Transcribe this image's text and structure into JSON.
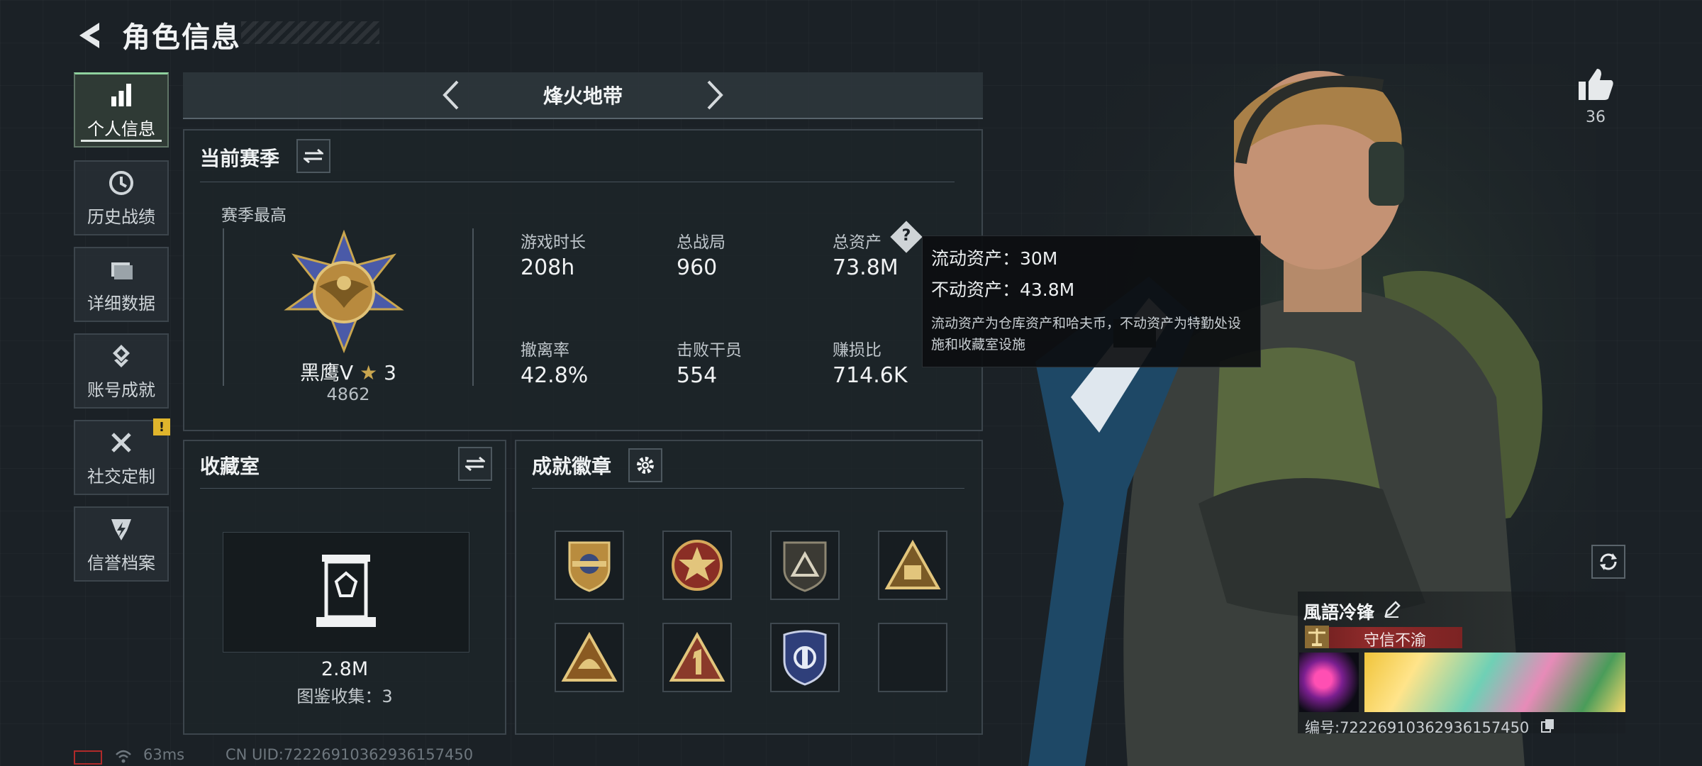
{
  "page": {
    "title": "角色信息"
  },
  "nav": [
    {
      "label": "个人信息",
      "icon": "bar-chart-icon",
      "active": true
    },
    {
      "label": "历史战绩",
      "icon": "history-clock-icon"
    },
    {
      "label": "详细数据",
      "icon": "folder-icon"
    },
    {
      "label": "账号成就",
      "icon": "achievement-icon"
    },
    {
      "label": "社交定制",
      "icon": "tools-icon",
      "alert": "!"
    },
    {
      "label": "信誉档案",
      "icon": "shield-bolt-icon"
    }
  ],
  "mode": {
    "current": "烽火地带"
  },
  "season": {
    "title": "当前赛季",
    "best_label": "赛季最高",
    "rank_name": "黑鹰Ⅴ",
    "rank_stars": "3",
    "rank_points": "4862",
    "stats": [
      {
        "label": "游戏时长",
        "value": "208h"
      },
      {
        "label": "总战局",
        "value": "960"
      },
      {
        "label": "总资产",
        "value": "73.8M"
      },
      {
        "label": "撤离率",
        "value": "42.8%"
      },
      {
        "label": "击败干员",
        "value": "554"
      },
      {
        "label": "赚损比",
        "value": "714.6K"
      }
    ]
  },
  "tooltip": {
    "liquid": "流动资产：30M",
    "fixed": "不动资产：43.8M",
    "desc": "流动资产为仓库资产和哈夫币，不动资产为特勤处设施和收藏室设施"
  },
  "collection": {
    "title": "收藏室",
    "value": "2.8M",
    "catalog": "图鉴收集：3"
  },
  "badges": {
    "title": "成就徽章",
    "items": [
      "winged-crest-badge",
      "star-medal-badge",
      "mountain-shield-badge",
      "triangle-emblem-badge",
      "triangle-helmet-badge",
      "number-one-badge",
      "police-shield-badge",
      "empty-slot"
    ]
  },
  "player": {
    "likes": "36",
    "name": "風語冷锋",
    "reputation": "守信不渝",
    "id": "编号:72226910362936157450"
  },
  "status": {
    "ping": "63ms",
    "uid": "CN UID:72226910362936157450"
  },
  "colors": {
    "accent_green": "#8fd19e",
    "reputation_red": "#8e2a2a",
    "alert_yellow": "#e0b52c"
  }
}
